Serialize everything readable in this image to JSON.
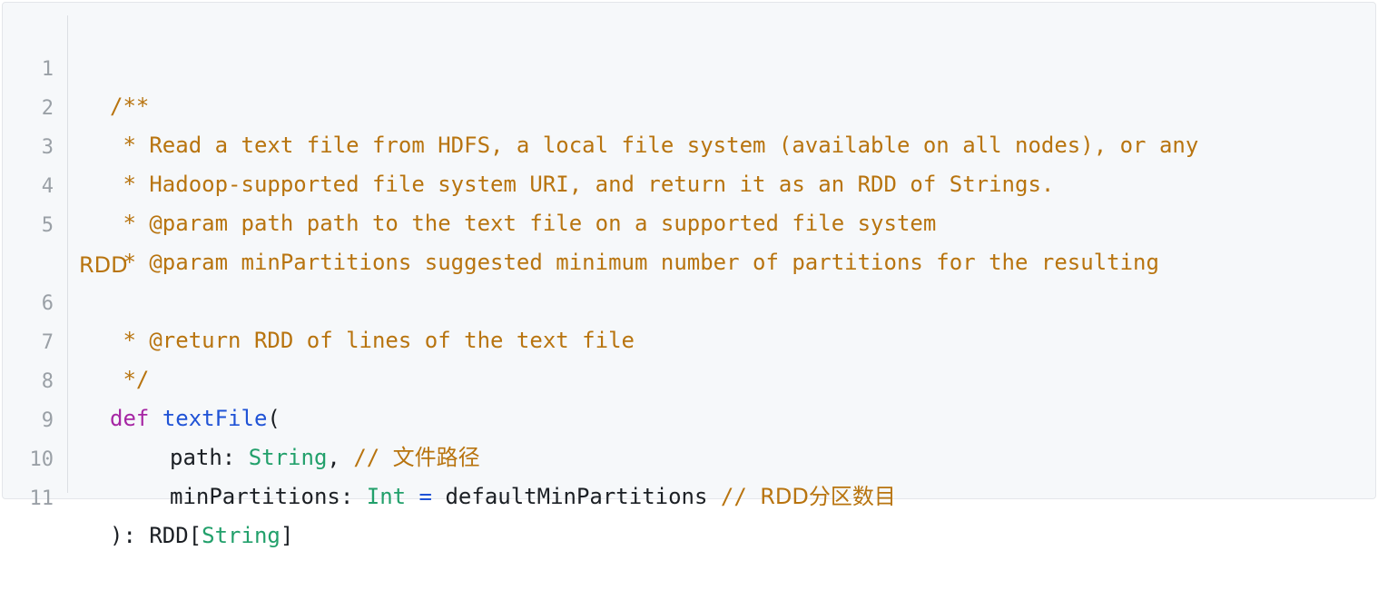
{
  "line_numbers": [
    "1",
    "2",
    "3",
    "4",
    "5",
    "6",
    "7",
    "8",
    "9",
    "10",
    "11"
  ],
  "lines": {
    "l1": "/**",
    "l2": " * Read a text file from HDFS, a local file system (available on all nodes), or any",
    "l3": " * Hadoop-supported file system URI, and return it as an RDD of Strings.",
    "l4": " * @param path path to the text file on a supported file system",
    "l5": " * @param minPartitions suggested minimum number of partitions for the resulting",
    "l5_wrap": "RDD",
    "l6": " * @return RDD of lines of the text file",
    "l7": " */",
    "l8_kw": "def",
    "l8_fn": "textFile",
    "l8_paren": "(",
    "l9_param": "path",
    "l9_colon": ": ",
    "l9_type": "String",
    "l9_comma": ", ",
    "l9_comment": "// ",
    "l9_comment_cn": "文件路径",
    "l10_param": "minPartitions",
    "l10_colon": ": ",
    "l10_type": "Int",
    "l10_eq": " = ",
    "l10_default": "defaultMinPartitions",
    "l10_comment": " // ",
    "l10_comment_cn": "RDD分区数目",
    "l11_close": "): RDD",
    "l11_lb": "[",
    "l11_type": "String",
    "l11_rb": "]"
  },
  "colors": {
    "comment": "#b8740f",
    "keyword": "#a626a4",
    "function": "#2053d6",
    "type": "#22a06b",
    "plain": "#1b1f24",
    "line_number": "#9aa0a6",
    "background": "#f6f8fa"
  }
}
